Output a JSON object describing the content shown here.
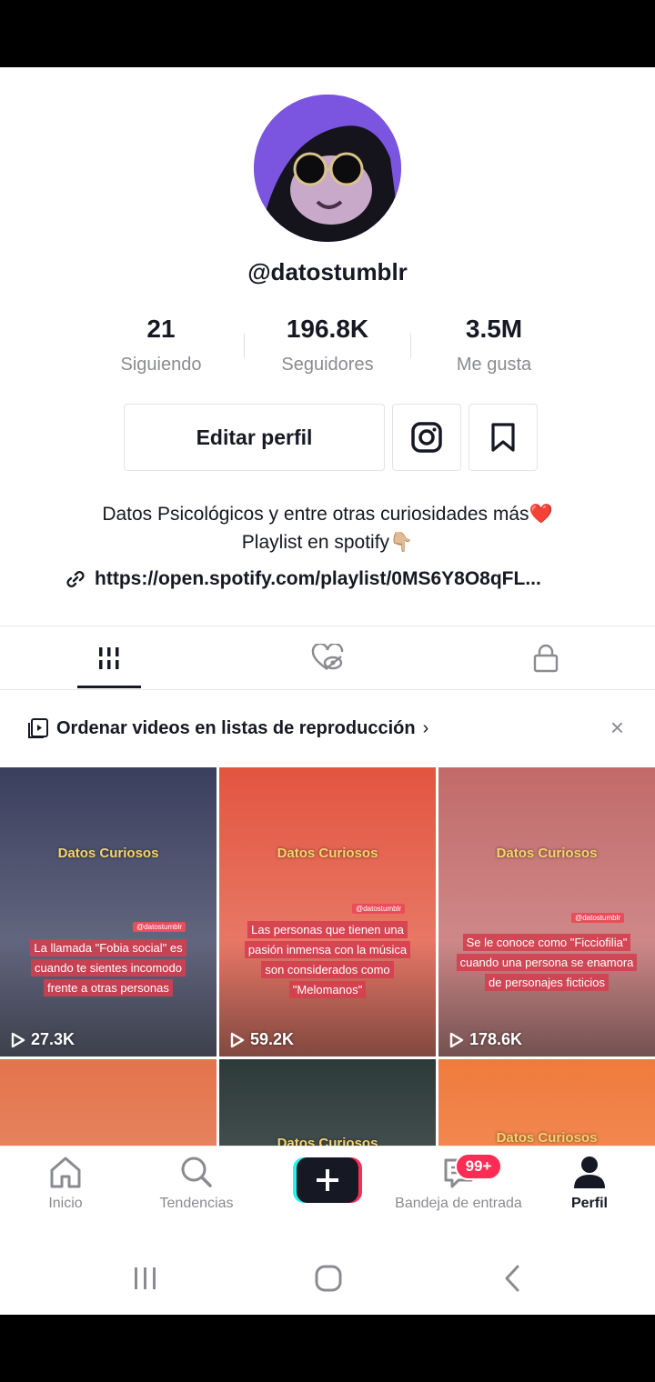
{
  "profile": {
    "username": "@datostumblr",
    "stats": [
      {
        "value": "21",
        "label": "Siguiendo"
      },
      {
        "value": "196.8K",
        "label": "Seguidores"
      },
      {
        "value": "3.5M",
        "label": "Me gusta"
      }
    ],
    "edit_label": "Editar perfil",
    "bio_line1": "Datos Psicológicos y entre otras curiosidades más❤️",
    "bio_line2": "Playlist en spotify👇🏼",
    "link": "https://open.spotify.com/playlist/0MS6Y8O8qFL..."
  },
  "tabs": [
    {
      "icon": "grid-icon",
      "active": true
    },
    {
      "icon": "liked-hidden-icon",
      "active": false
    },
    {
      "icon": "lock-icon",
      "active": false
    }
  ],
  "playlist_banner": {
    "label": "Ordenar videos en listas de reproducción",
    "chevron": "›",
    "close": "×"
  },
  "videos": [
    {
      "title": "Datos Curiosos",
      "handle": "@datostumblr",
      "caption": "La llamada \"Fobia social\" es cuando te sientes incomodo frente a otras personas",
      "plays": "27.3K",
      "bg": "#3a3f5e"
    },
    {
      "title": "Datos Curiosos",
      "handle": "@datostumblr",
      "caption": "Las personas que tienen una pasión inmensa con la música son considerados como \"Melomanos\"",
      "plays": "59.2K",
      "bg": "#e2553f"
    },
    {
      "title": "Datos Curiosos",
      "handle": "@datostumblr",
      "caption": "Se le conoce como \"Ficciofilia\" cuando una persona se enamora de personajes ficticios",
      "plays": "178.6K",
      "bg": "#c26a6a"
    },
    {
      "title": "",
      "handle": "",
      "caption": "",
      "plays": "",
      "bg": "#e3744c"
    },
    {
      "title": "Datos Curiosos",
      "handle": "",
      "caption": "",
      "plays": "",
      "bg": "#2d3a3a"
    },
    {
      "title": "Datos Curiosos",
      "handle": "",
      "caption": "",
      "plays": "",
      "bg": "#f07a3c"
    }
  ],
  "bottom_nav": [
    {
      "label": "Inicio",
      "icon": "home-icon"
    },
    {
      "label": "Tendencias",
      "icon": "search-icon"
    },
    {
      "label": "",
      "icon": "create-icon"
    },
    {
      "label": "Bandeja de entrada",
      "icon": "inbox-icon",
      "badge": "99+"
    },
    {
      "label": "Perfil",
      "icon": "profile-icon"
    }
  ],
  "colors": {
    "accent": "#fe2c55",
    "text": "#161823",
    "muted": "#8a8b91"
  }
}
